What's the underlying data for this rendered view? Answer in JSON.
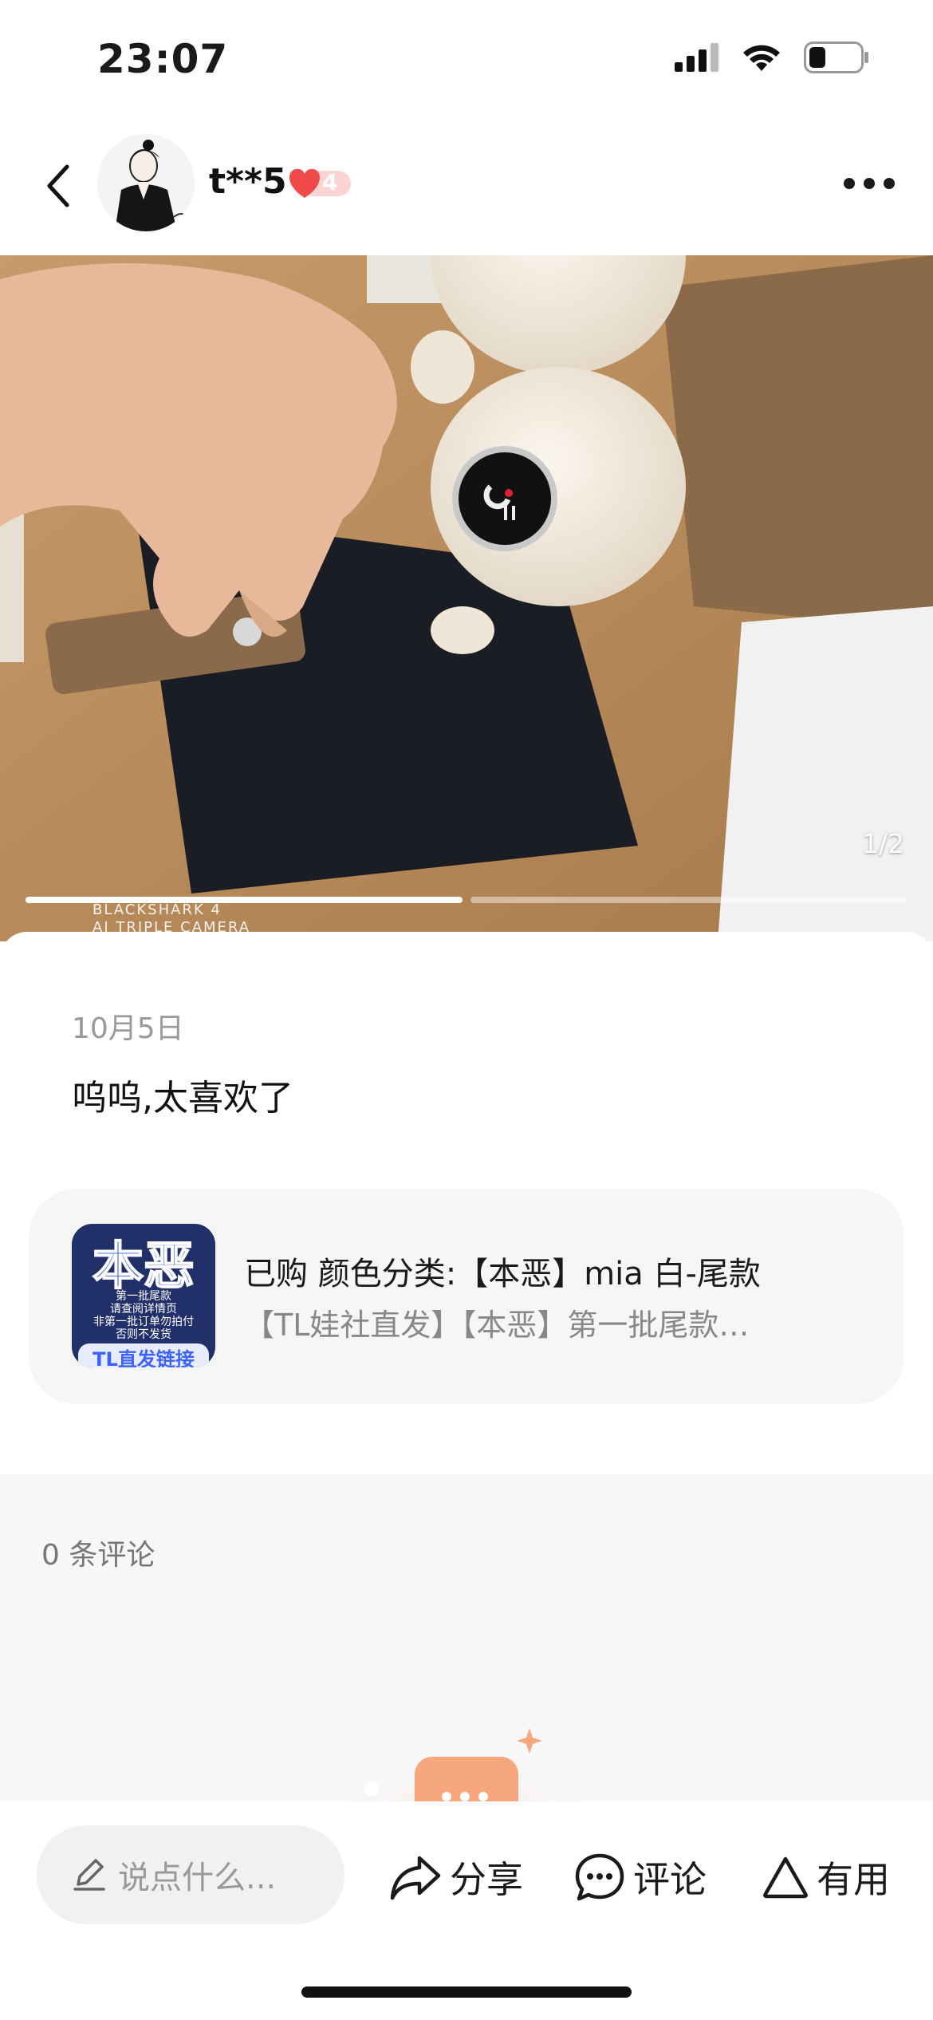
{
  "status_bar": {
    "time": "23:07"
  },
  "header": {
    "username": "t**5",
    "level": "4"
  },
  "photo": {
    "counter": "1/2",
    "pages_total": 2,
    "current_page": 1,
    "watermark_line1": "BLACKSHARK 4",
    "watermark_line2": "AI TRIPLE CAMERA"
  },
  "post": {
    "date": "10月5日",
    "text": "呜呜,太喜欢了"
  },
  "product": {
    "variant": "已购 颜色分类:【本恶】mia 白-尾款",
    "title": "【TL娃社直发】【本恶】第一批尾款…",
    "thumb_big": "本恶",
    "thumb_lines": [
      "第一批尾款",
      "请查阅详情页",
      "非第一批订单勿拍付",
      "否则不发货"
    ],
    "thumb_bottom": "TL直发链接"
  },
  "comments": {
    "count_label": "0 条评论"
  },
  "bottom_bar": {
    "input_placeholder": "说点什么...",
    "share_label": "分享",
    "comment_label": "评论",
    "useful_label": "有用"
  },
  "icons": {
    "back": "chevron-left-icon",
    "more": "more-dots-icon",
    "heart": "heart-icon",
    "pencil": "pencil-icon",
    "share": "share-arrow-icon",
    "comment": "chat-bubble-icon",
    "useful": "triangle-icon"
  },
  "colors": {
    "accent": "#f25b5b",
    "empty_illustration": "#f6a77e"
  }
}
